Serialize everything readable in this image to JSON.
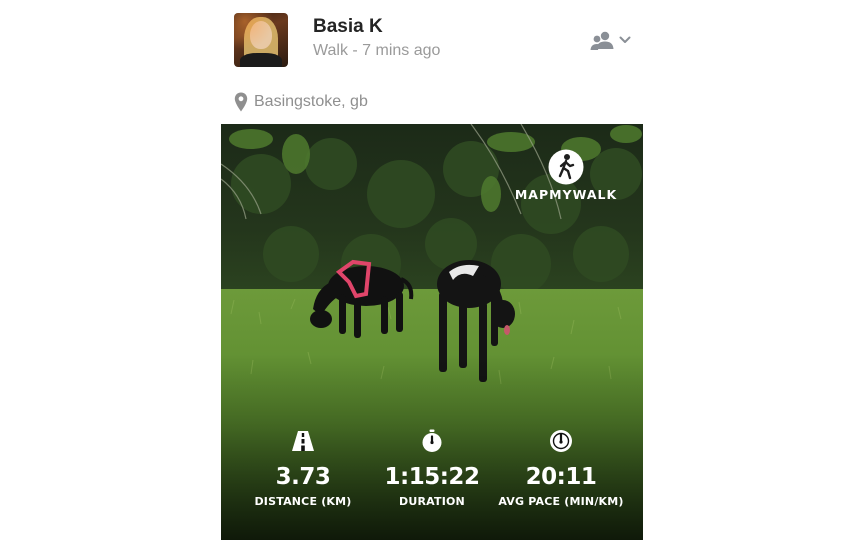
{
  "post": {
    "user_name": "Basia K",
    "activity_meta": "Walk - 7 mins ago",
    "privacy_icon": "friends-icon",
    "location": "Basingstoke, gb"
  },
  "photo": {
    "brand": "MAPMYWALK",
    "brand_icon": "walker-icon"
  },
  "stats": [
    {
      "icon": "road-icon",
      "value": "3.73",
      "label": "DISTANCE (KM)"
    },
    {
      "icon": "stopwatch-icon",
      "value": "1:15:22",
      "label": "DURATION"
    },
    {
      "icon": "speedometer-icon",
      "value": "20:11",
      "label": "AVG PACE (MIN/KM)"
    }
  ],
  "colors": {
    "name_text": "#242424",
    "meta_text": "#9a9a9a",
    "overlay_text": "#ffffff"
  }
}
